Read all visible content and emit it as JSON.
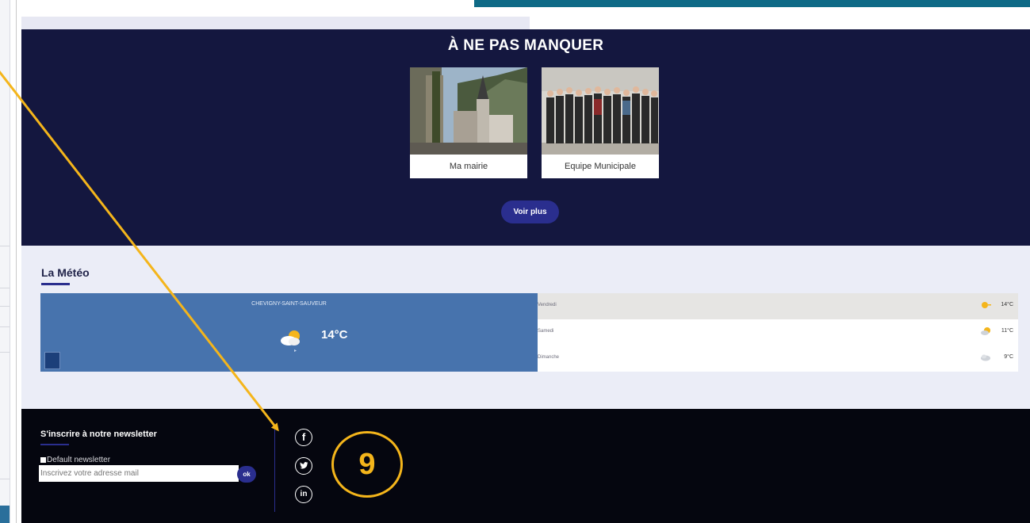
{
  "featured": {
    "title": "À NE PAS MANQUER",
    "cards": [
      {
        "caption": "Ma mairie"
      },
      {
        "caption": "Equipe Municipale"
      }
    ],
    "more_button": "Voir plus"
  },
  "weather": {
    "title": "La Météo",
    "city": "CHEVIGNY-SAINT-SAUVEUR",
    "current_temp": "14°C",
    "forecast": [
      {
        "day": "Vendredi",
        "temp": "14°C",
        "icon": "sun-icon"
      },
      {
        "day": "Samedi",
        "temp": "11°C",
        "icon": "sun-cloud-icon"
      },
      {
        "day": "Dimanche",
        "temp": "9°C",
        "icon": "cloud-icon"
      }
    ]
  },
  "footer": {
    "newsletter_title": "S'inscrire à notre newsletter",
    "checkbox_label": "Default newsletter",
    "email_placeholder": "Inscrivez votre adresse mail",
    "ok_label": "ok",
    "social": [
      "facebook-icon",
      "twitter-icon",
      "linkedin-icon"
    ]
  },
  "annotation": {
    "number": "9",
    "color": "#f4b51b"
  },
  "colors": {
    "navy": "#14173f",
    "button": "#2a2e8e",
    "weather_blue": "#4773ad",
    "footer": "#05060f",
    "teal": "#0e6a86"
  }
}
